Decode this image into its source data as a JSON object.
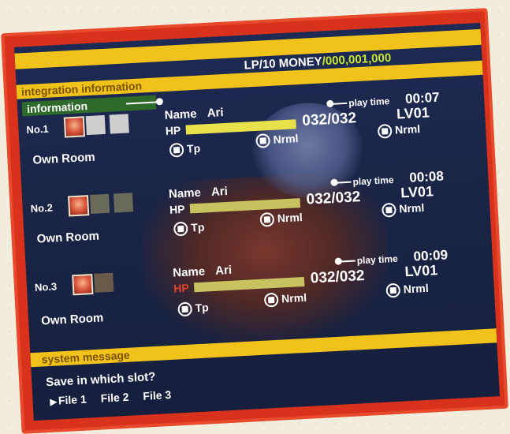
{
  "header": {
    "integration_title": "integration information",
    "lp": "LP/10",
    "money_label": "MONEY",
    "money_value": "/000,001,000",
    "information_title": "information"
  },
  "slots": [
    {
      "number": "No.1",
      "location": "Own Room",
      "name_label": "Name",
      "name": "Ari",
      "hp_label": "HP",
      "hp": "032/032",
      "hp_fraction": 1.0,
      "level": "LV01",
      "playtime_label": "play time",
      "playtime": "00:07",
      "option_tp": "Tp",
      "option_nrml_a": "Nrml",
      "option_nrml_b": "Nrml"
    },
    {
      "number": "No.2",
      "location": "Own Room",
      "name_label": "Name",
      "name": "Ari",
      "hp_label": "HP",
      "hp": "032/032",
      "hp_fraction": 1.0,
      "level": "LV01",
      "playtime_label": "play time",
      "playtime": "00:08",
      "option_tp": "Tp",
      "option_nrml_a": "Nrml",
      "option_nrml_b": "Nrml"
    },
    {
      "number": "No.3",
      "location": "Own Room",
      "name_label": "Name",
      "name": "Ari",
      "hp_label": "HP",
      "hp": "032/032",
      "hp_fraction": 1.0,
      "level": "LV01",
      "playtime_label": "play time",
      "playtime": "00:09",
      "option_tp": "Tp",
      "option_nrml_a": "Nrml",
      "option_nrml_b": "Nrml"
    }
  ],
  "system": {
    "title": "system message",
    "prompt": "Save in which slot?",
    "files": [
      "File 1",
      "File 2",
      "File 3"
    ]
  },
  "colors": {
    "frame": "#d8321c",
    "accent_yellow": "#f0c21a",
    "money_green": "#c9e832",
    "info_green": "#2e6a2a",
    "panel_navy": "#1d2a54"
  }
}
